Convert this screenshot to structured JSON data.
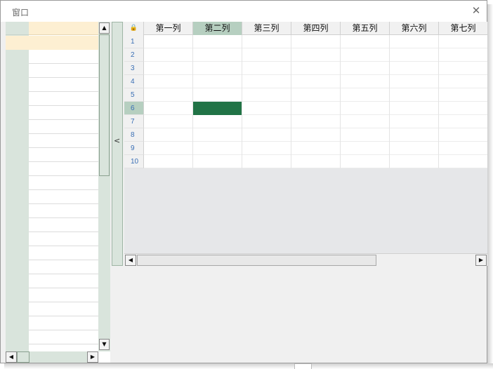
{
  "window": {
    "title": "窗口",
    "close_glyph": "✕"
  },
  "left_panel": {
    "scroll_up": "▲",
    "scroll_down": "▼",
    "scroll_left": "◀",
    "scroll_right": "▶"
  },
  "splitter": {
    "glyph": "<"
  },
  "grid": {
    "corner_glyph": "🔒",
    "columns": [
      "第一列",
      "第二列",
      "第三列",
      "第四列",
      "第五列",
      "第六列",
      "第七列"
    ],
    "rows": [
      "1",
      "2",
      "3",
      "4",
      "5",
      "6",
      "7",
      "8",
      "9",
      "10"
    ],
    "selected_column": "第二列",
    "selected_row": "6",
    "scroll_left": "◀",
    "scroll_right": "▶"
  },
  "colors": {
    "selection": "#217346",
    "header_highlight": "#b6cfc0",
    "row_header_bg": "#d9e4dc",
    "left_header_bg": "#fdefd2"
  }
}
